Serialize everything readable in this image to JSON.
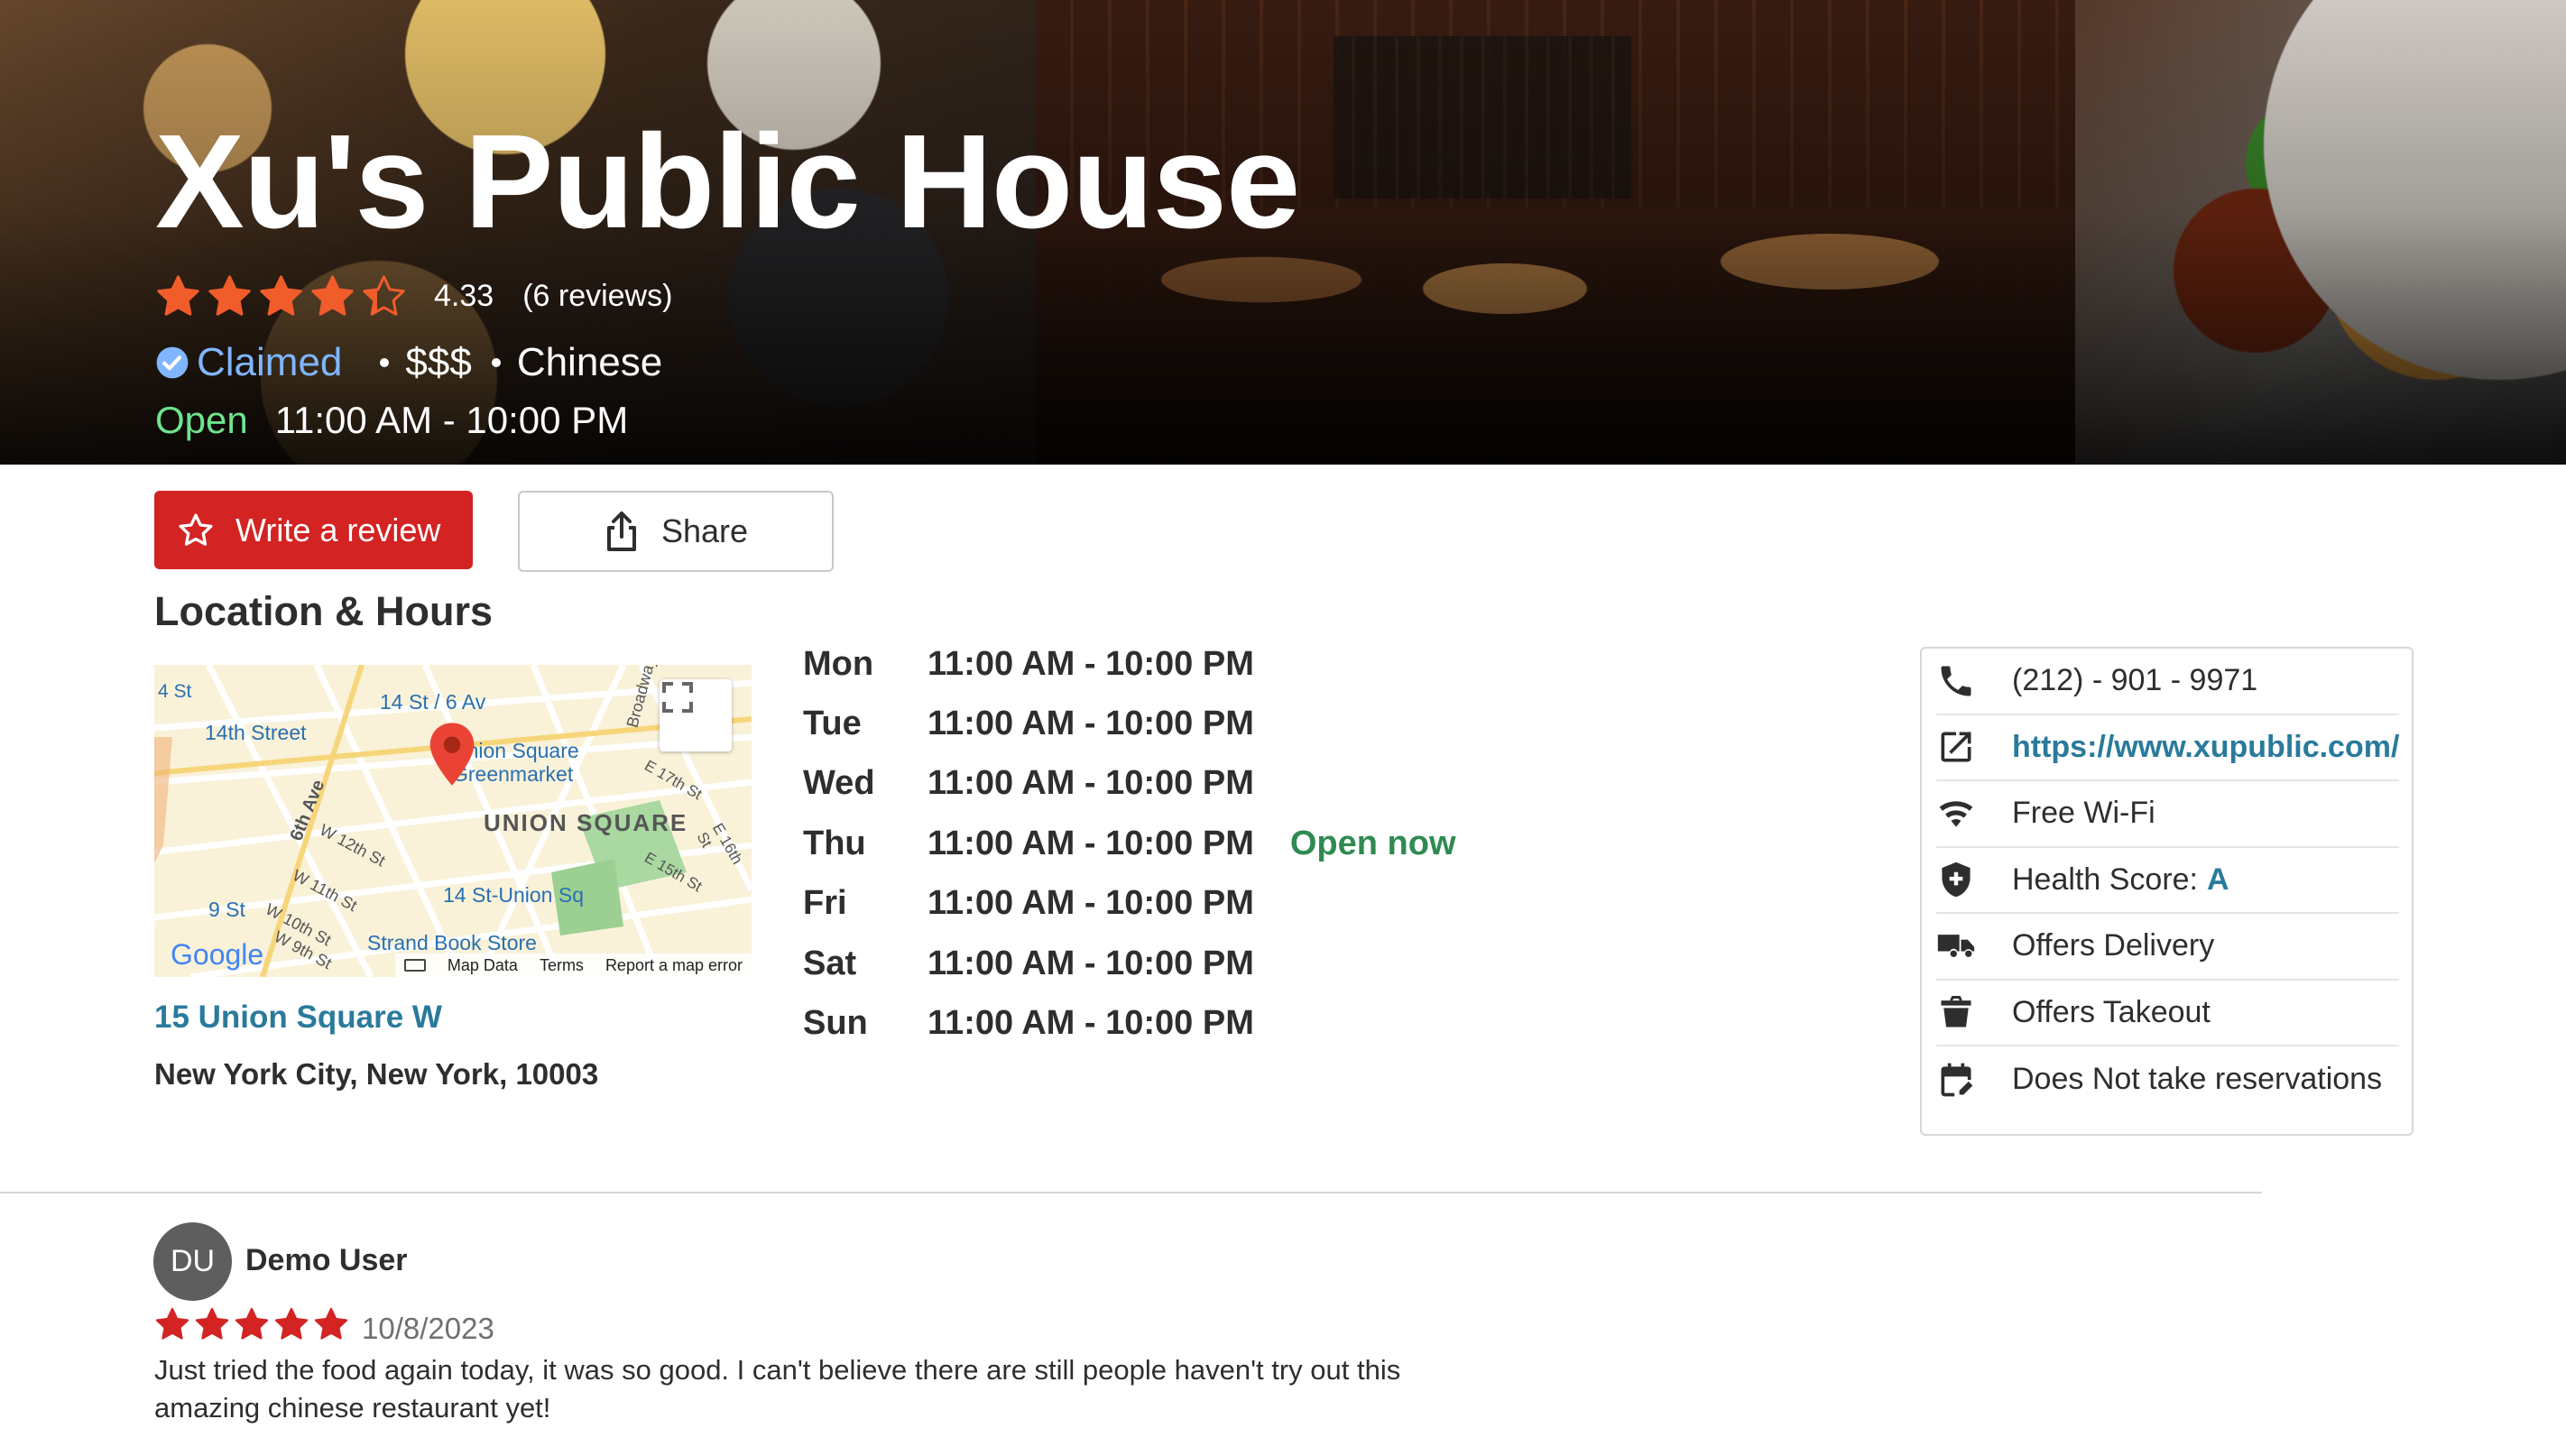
{
  "business": {
    "name": "Xu's Public House",
    "rating": "4.33",
    "review_count": "(6 reviews)",
    "claimed": "Claimed",
    "price": "$$$",
    "category": "Chinese",
    "open_status": "Open",
    "today_hours": "11:00 AM - 10:00 PM",
    "star_fill": [
      1,
      1,
      1,
      1,
      0.33
    ]
  },
  "actions": {
    "write_review": "Write a review",
    "share": "Share"
  },
  "location": {
    "section_title": "Location & Hours",
    "address_line1": "15 Union Square W",
    "city": "New York City,",
    "state": "New York,",
    "zip": "10003",
    "map": {
      "labels": [
        "4 St",
        "14th Street",
        "14 St / 6 Av",
        "Union Square Greenmarket",
        "UNION SQUARE",
        "6th Ave",
        "W 12th St",
        "W 11th St",
        "W 10th St",
        "W 9th St",
        "14 St-Union Sq",
        "9 St",
        "Strand Book Store",
        "E 17th St",
        "E 16th St",
        "E 15th St",
        "Broadway",
        "Google",
        "Map Data",
        "Terms",
        "Report a map error"
      ]
    }
  },
  "hours": [
    {
      "day": "Mon",
      "time": "11:00 AM - 10:00 PM",
      "note": ""
    },
    {
      "day": "Tue",
      "time": "11:00 AM - 10:00 PM",
      "note": ""
    },
    {
      "day": "Wed",
      "time": "11:00 AM - 10:00 PM",
      "note": ""
    },
    {
      "day": "Thu",
      "time": "11:00 AM - 10:00 PM",
      "note": "Open now"
    },
    {
      "day": "Fri",
      "time": "11:00 AM - 10:00 PM",
      "note": ""
    },
    {
      "day": "Sat",
      "time": "11:00 AM - 10:00 PM",
      "note": ""
    },
    {
      "day": "Sun",
      "time": "11:00 AM - 10:00 PM",
      "note": ""
    }
  ],
  "info_card": {
    "phone": "(212) - 901 - 9971",
    "website": "https://www.xupublic.com/",
    "wifi": "Free Wi-Fi",
    "health_label": "Health Score:",
    "health_grade": "A",
    "delivery": "Offers Delivery",
    "takeout": "Offers Takeout",
    "reservations": "Does Not take reservations"
  },
  "review": {
    "avatar_initials": "DU",
    "user": "Demo User",
    "date": "10/8/2023",
    "stars": 5,
    "text": "Just tried the food again today, it was so good. I can't believe there are still people haven't try out this amazing chinese restaurant yet!"
  },
  "colors": {
    "brand_red": "#d32323",
    "star_orange": "#f15c2b",
    "link_blue": "#2a7a9c",
    "open_green": "#2f8a52",
    "claimed_blue": "#7fb6ff"
  }
}
